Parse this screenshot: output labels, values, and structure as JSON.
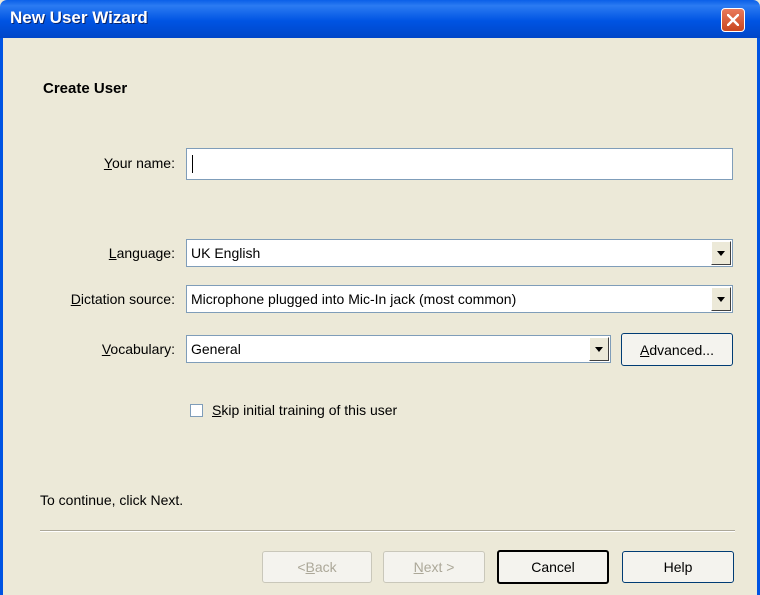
{
  "window": {
    "title": "New User Wizard"
  },
  "page": {
    "heading": "Create User",
    "instruction": "To continue, click Next."
  },
  "form": {
    "name_label_prefix": "",
    "name_label_accel": "Y",
    "name_label_rest": "our name:",
    "name_value": "",
    "language_label_accel": "L",
    "language_label_rest": "anguage:",
    "language_value": "UK English",
    "dictation_label_accel": "D",
    "dictation_label_rest": "ictation source:",
    "dictation_value": "Microphone plugged into Mic-In jack (most common)",
    "vocabulary_label_accel": "V",
    "vocabulary_label_rest": "ocabulary:",
    "vocabulary_value": "General",
    "advanced_accel": "A",
    "advanced_rest": "dvanced...",
    "skip_training_accel": "S",
    "skip_training_rest": "kip initial training of this user",
    "skip_training_checked": false
  },
  "buttons": {
    "back_prefix": "< ",
    "back_accel": "B",
    "back_rest": "ack",
    "next_accel": "N",
    "next_rest": "ext >",
    "cancel": "Cancel",
    "help": "Help"
  },
  "icons": {
    "close": "close-icon",
    "dropdown": "dropdown-arrow-icon"
  }
}
